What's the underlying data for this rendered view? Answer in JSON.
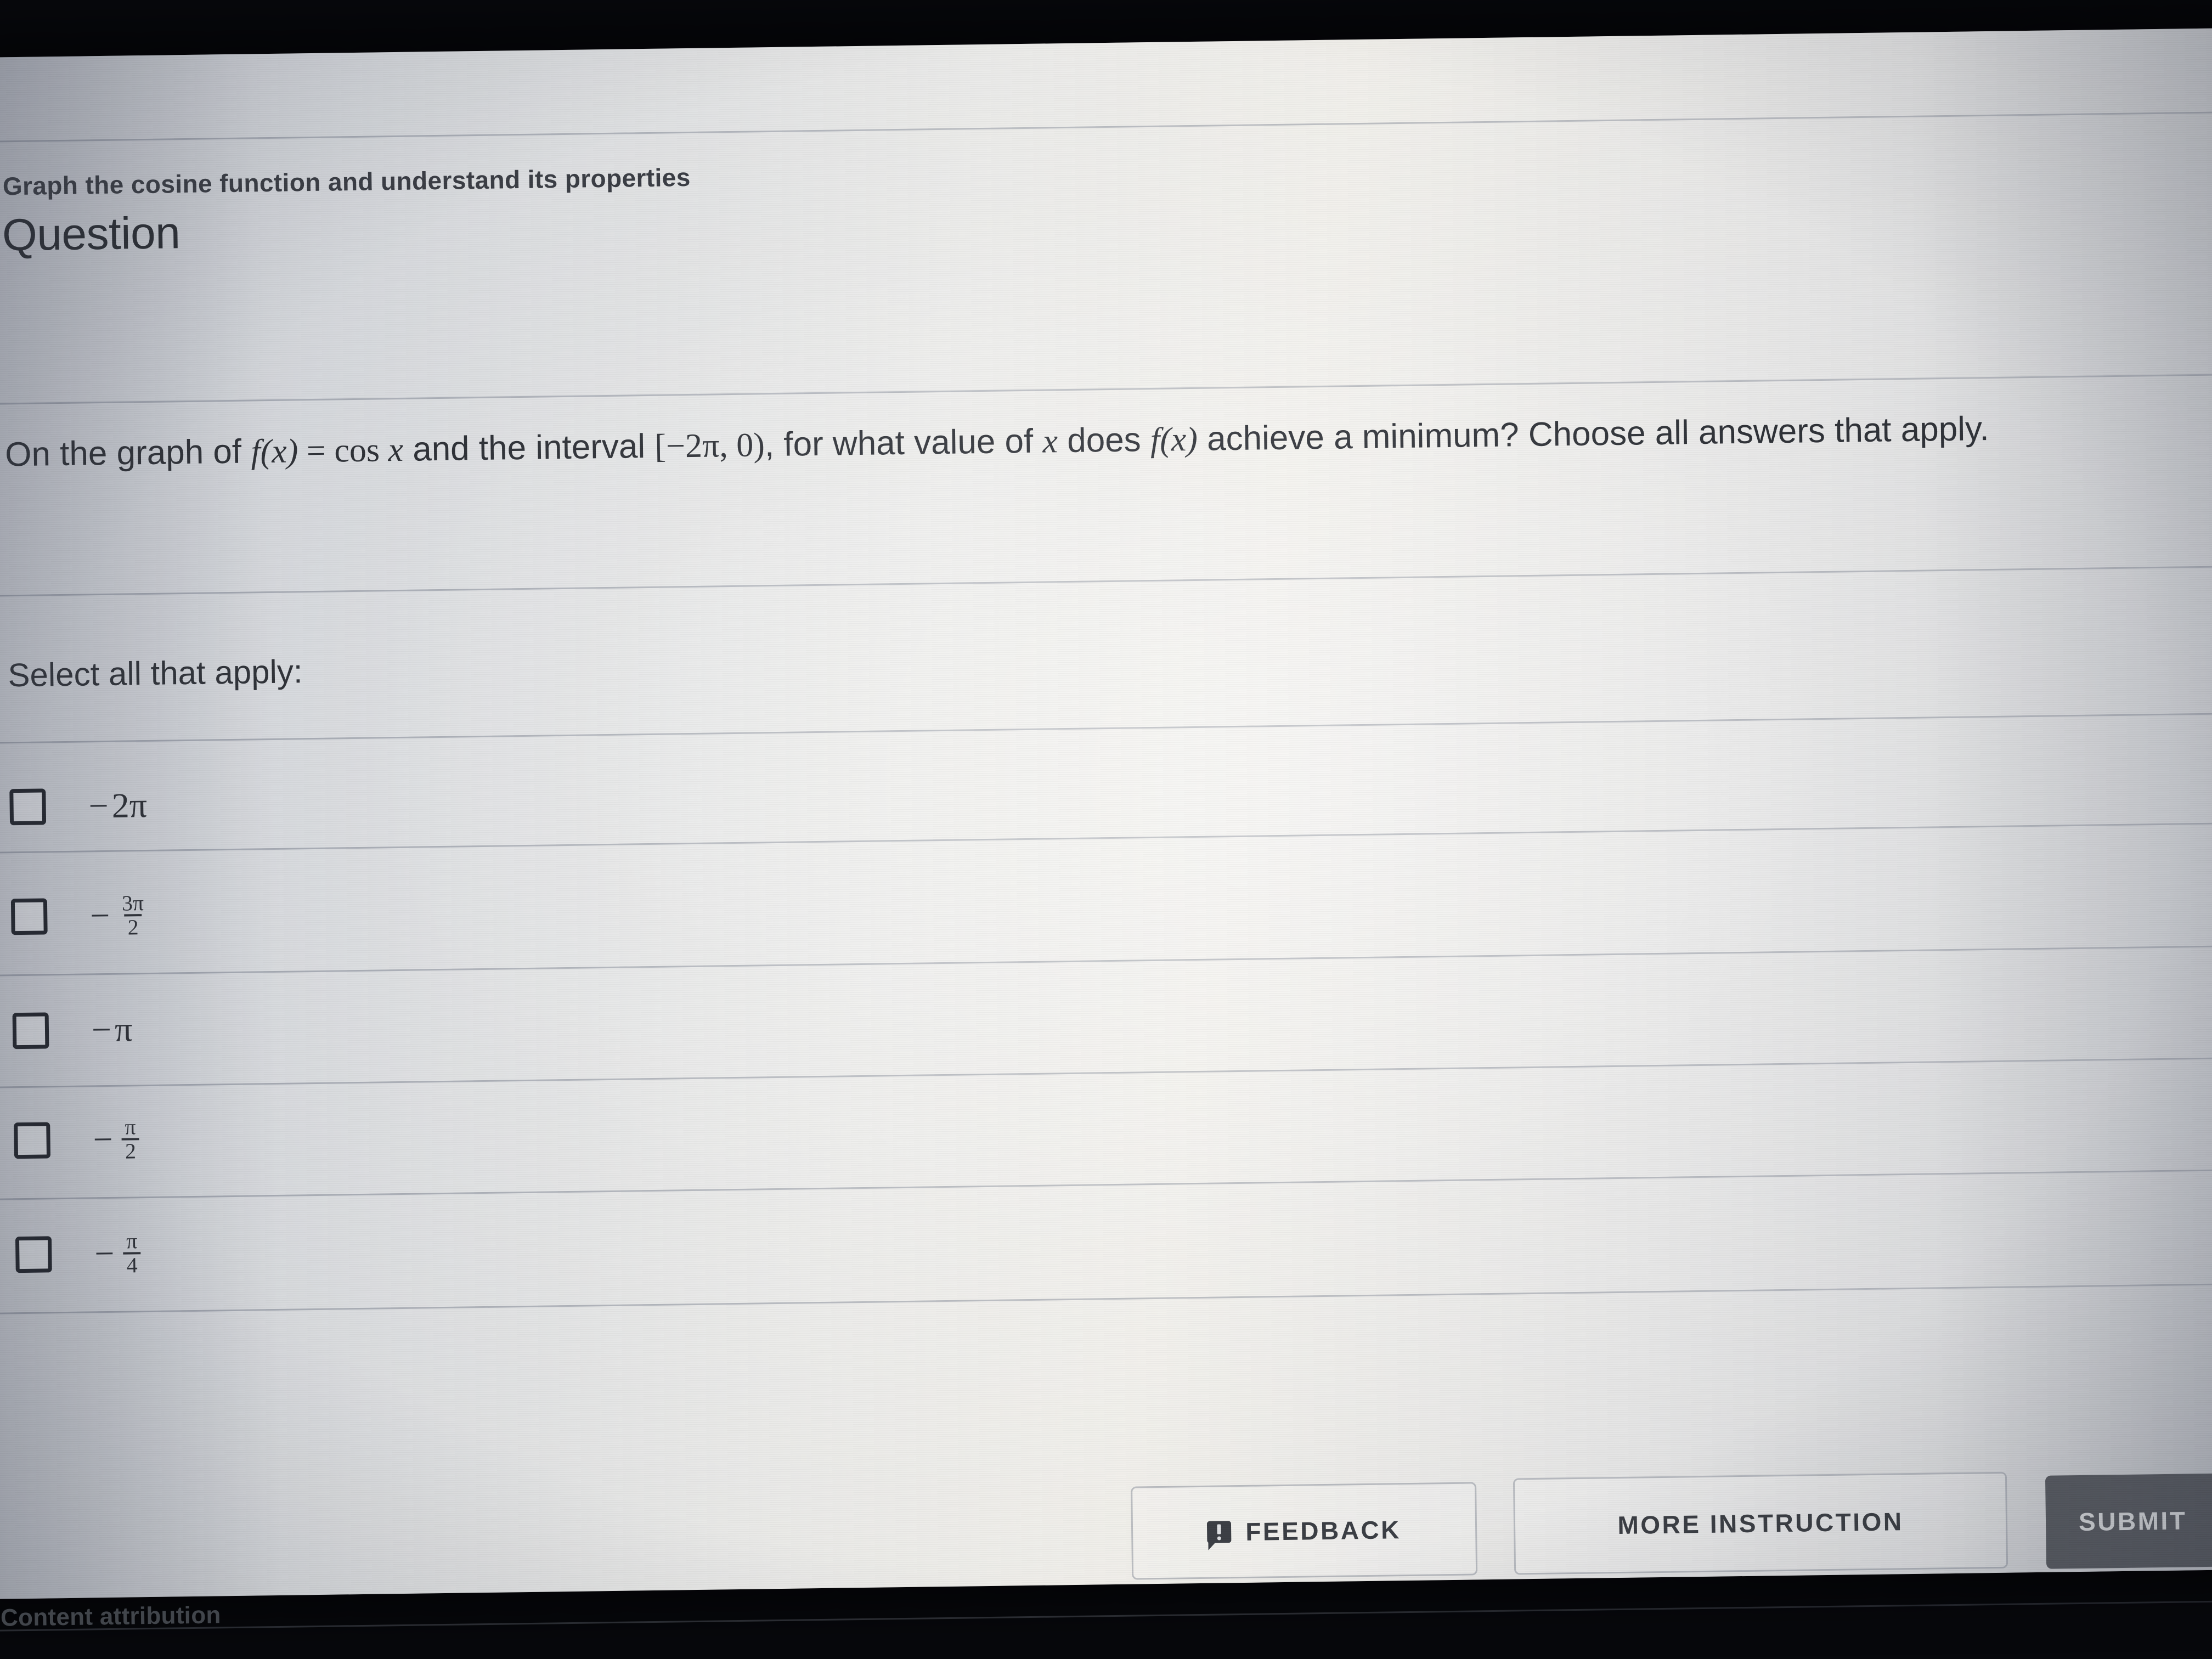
{
  "skill": {
    "title": "Graph the cosine function and understand its properties"
  },
  "heading": {
    "text": "Question"
  },
  "question": {
    "segment_1": "On the graph of ",
    "fx_1": "f",
    "paren_x_1": "(x)",
    "equals": " = ",
    "cos": "cos",
    "var_x_1": "x",
    "segment_2": " and the interval ",
    "interval": "[−2π, 0)",
    "segment_3": ", for what value of ",
    "var_x_2": "x",
    "segment_4": " does ",
    "fx_2": "f",
    "paren_x_2": "(x)",
    "segment_5": " achieve a minimum? Choose all answers that apply.",
    "plain_text": "On the graph of f(x) = cos x and the interval [−2π, 0), for what value of x does f(x) achieve a minimum? Choose all answers that apply."
  },
  "select_prompt": {
    "label": "Select all that apply:"
  },
  "options": [
    {
      "id": "opt-neg-2pi",
      "display": "−2π",
      "kind": "plain",
      "minus": "−",
      "body": "2π",
      "checked": false
    },
    {
      "id": "opt-neg-3pi-2",
      "display": "− 3π/2",
      "kind": "fraction",
      "minus": "−",
      "numerator": "3π",
      "denominator": "2",
      "checked": false
    },
    {
      "id": "opt-neg-pi",
      "display": "−π",
      "kind": "plain",
      "minus": "−",
      "body": "π",
      "checked": false
    },
    {
      "id": "opt-neg-pi-2",
      "display": "− π/2",
      "kind": "fraction",
      "minus": "−",
      "numerator": "π",
      "denominator": "2",
      "checked": false
    },
    {
      "id": "opt-neg-pi-4",
      "display": "− π/4",
      "kind": "fraction",
      "minus": "−",
      "numerator": "π",
      "denominator": "4",
      "checked": false
    }
  ],
  "footer": {
    "feedback_label": "FEEDBACK",
    "more_instruction_label": "MORE INSTRUCTION",
    "submit_label": "SUBMIT",
    "content_attribution": "Content attribution"
  },
  "colors": {
    "submit_background": "#575a60",
    "submit_text": "#d6d8da",
    "text_primary": "#2c2f35",
    "rule": "#8a909c",
    "checkbox_border": "#20232a"
  }
}
